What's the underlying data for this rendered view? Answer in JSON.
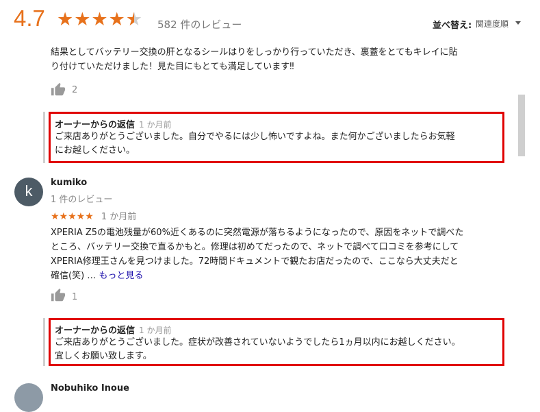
{
  "header": {
    "rating": "4.7",
    "stars": "★★★★",
    "review_count": "582 件のレビュー",
    "sort_label": "並べ替え:",
    "sort_value": "関連度順"
  },
  "review1": {
    "text_line1": "結果としてバッテリー交換の肝となるシールはりをしっかり行っていただき、裏蓋をとてもキレイに貼",
    "text_line2": "り付けていただけました！見た目にもとても満足しています‼",
    "likes": "2",
    "reply": {
      "title": "オーナーからの返信",
      "date": "1 か月前",
      "line1": "ご来店ありがとうございました。自分でやるには少し怖いですよね。また何かございましたらお気軽",
      "line2": "にお越しください。"
    }
  },
  "review2": {
    "avatar_letter": "k",
    "author": "kumiko",
    "author_meta": "1 件のレビュー",
    "stars": "★★★★★",
    "date": "1 か月前",
    "text_line1": "XPERIA Z5の電池残量が60%近くあるのに突然電源が落ちるようになったので、原因をネットで調べた",
    "text_line2": "ところ、バッテリー交換で直るかもと。修理は初めてだったので、ネットで調べて口コミを参考にして",
    "text_line3": "XPERIA修理王さんを見つけました。72時間ドキュメントで観たお店だったので、ここなら大丈夫だと",
    "text_line4": "確信(笑) …",
    "more": "もっと見る",
    "likes": "1",
    "reply": {
      "title": "オーナーからの返信",
      "date": "1 か月前",
      "line1": "ご来店ありがとうございました。症状が改善されていないようでしたら1ヵ月以内にお越しください。",
      "line2": "宜しくお願い致します。"
    }
  },
  "review3": {
    "author": "Nobuhiko Inoue"
  },
  "colors": {
    "accent": "#e7711b",
    "highlight_frame": "#e00000",
    "link": "#1a0dab"
  }
}
